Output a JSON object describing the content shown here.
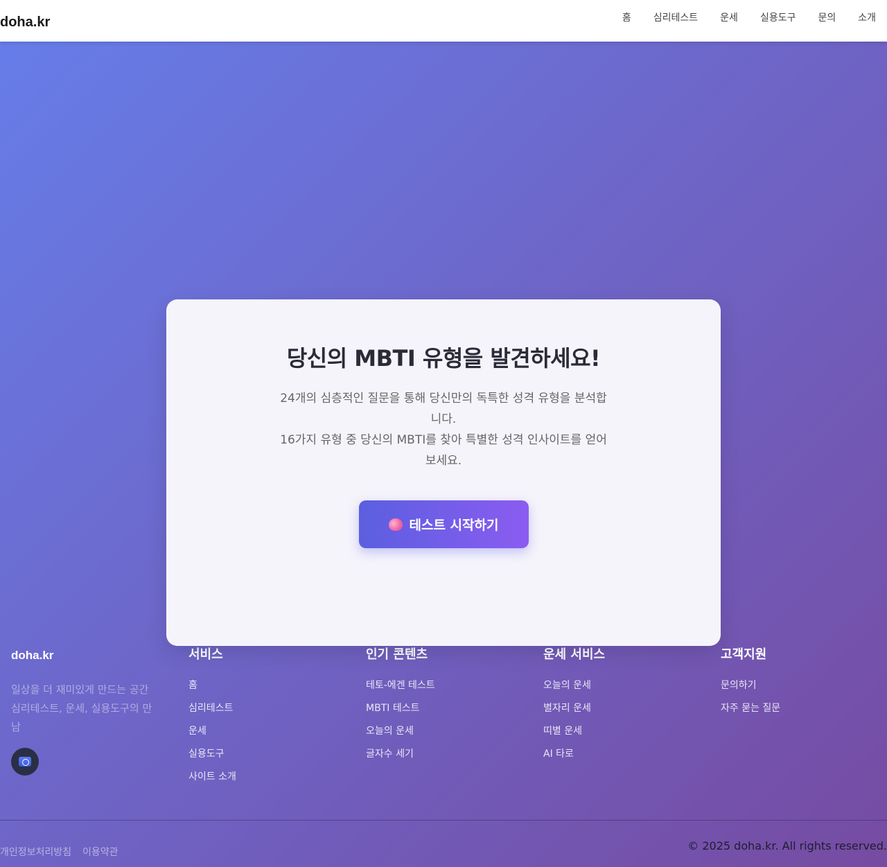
{
  "header": {
    "logo": "doha.kr",
    "nav": [
      "홈",
      "심리테스트",
      "운세",
      "실용도구",
      "문의",
      "소개"
    ]
  },
  "hero": {
    "title": "당신의 MBTI 유형을 발견하세요!",
    "description_line1": "24개의 심층적인 질문을 통해 당신만의 독특한 성격 유형을 분석합니다.",
    "description_line2": "16가지 유형 중 당신의 MBTI를 찾아 특별한 성격 인사이트를 얻어보세요.",
    "start_button": "테스트 시작하기",
    "start_button_icon": "brain-icon"
  },
  "footer": {
    "brand": "doha.kr",
    "tagline_line1": "일상을 더 재미있게 만드는 공간",
    "tagline_line2": "심리테스트, 운세, 실용도구의 만남",
    "social_icon": "instagram-icon",
    "columns": [
      {
        "title": "서비스",
        "links": [
          "홈",
          "심리테스트",
          "운세",
          "실용도구",
          "사이트 소개"
        ]
      },
      {
        "title": "인기 콘텐츠",
        "links": [
          "테토-에겐 테스트",
          "MBTI 테스트",
          "오늘의 운세",
          "글자수 세기"
        ]
      },
      {
        "title": "운세 서비스",
        "links": [
          "오늘의 운세",
          "별자리 운세",
          "띠별 운세",
          "AI 타로"
        ]
      },
      {
        "title": "고객지원",
        "links": [
          "문의하기",
          "자주 묻는 질문"
        ]
      }
    ],
    "legal": [
      "개인정보처리방침",
      "이용약관"
    ],
    "copyright": "© 2025 doha.kr. All rights reserved."
  },
  "colors": {
    "gradient_start": "#667eea",
    "gradient_end": "#764ba2",
    "button_start": "#5b5fe0",
    "button_end": "#8b5cf0"
  }
}
